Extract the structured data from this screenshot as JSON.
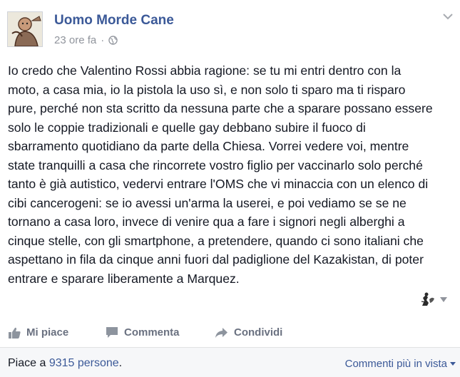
{
  "post": {
    "page_name": "Uomo Morde Cane",
    "timestamp": "23 ore fa",
    "separator": "·",
    "body": "Io credo che Valentino Rossi abbia ragione: se tu mi entri dentro con la moto, a casa mia, io la pistola la uso sì, e non solo ti sparo ma ti risparo pure, perché non sta scritto da nessuna parte che a sparare possano essere solo le coppie tradizionali e quelle gay debbano subire il fuoco di sbarramento quotidiano da parte della Chiesa. Vorrei vedere voi, mentre state tranquilli a casa che rincorrete vostro figlio per vaccinarlo solo perché tanto è già autistico, vedervi entrare l'OMS che vi minaccia con un elenco di cibi cancerogeni: se io avessi un'arma la userei, e poi vediamo se se ne tornano a casa loro, invece di venire qua a fare i signori negli alberghi a cinque stelle, con gli smartphone, a pretendere, quando ci sono italiani che aspettano in fila da cinque anni fuori dal padiglione del Kazakistan, di poter entrare e sparare liberamente a Marquez."
  },
  "actions": {
    "like": "Mi piace",
    "comment": "Commenta",
    "share": "Condividi"
  },
  "footer": {
    "likes_prefix": "Piace a ",
    "likes_count": "9315 persone",
    "likes_suffix": ".",
    "sort_label": "Commenti più in vista"
  },
  "icons": {
    "avatar": "page-avatar-cartoon",
    "privacy": "globe-icon",
    "menu": "chevron-down-icon",
    "audience": "audience-selector-icon"
  },
  "colors": {
    "link": "#3b5998",
    "muted": "#90949c",
    "action": "#6a7180",
    "footer_bg": "#f6f7f9"
  }
}
